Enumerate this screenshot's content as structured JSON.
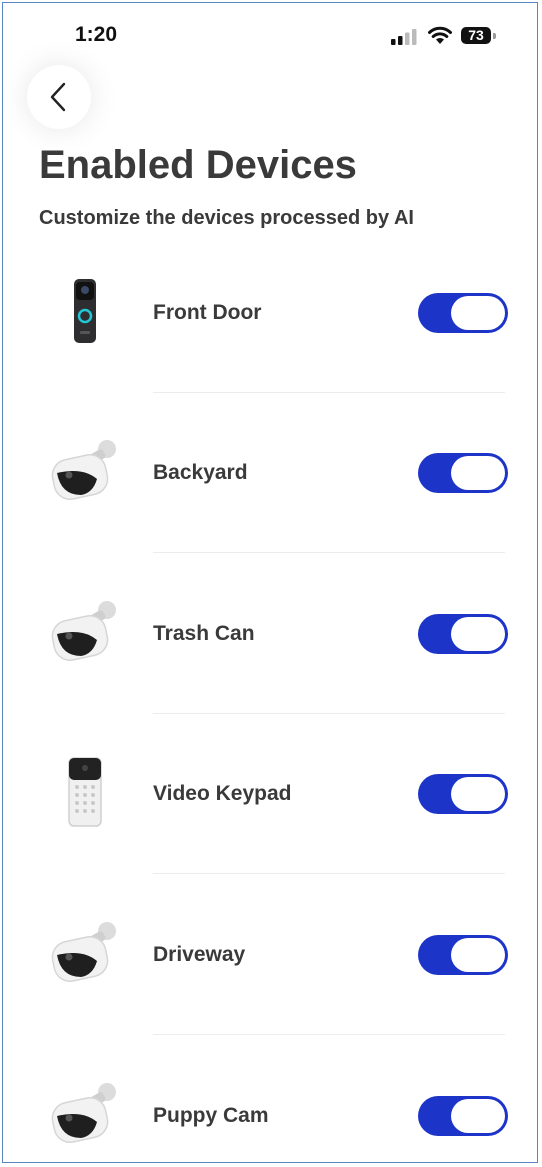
{
  "status_bar": {
    "time": "1:20",
    "battery": "73",
    "icons": [
      "cellular-signal-icon",
      "wifi-icon",
      "battery-icon"
    ]
  },
  "header": {
    "back_icon": "chevron-left-icon",
    "title": "Enabled Devices",
    "subtitle": "Customize the devices processed by AI"
  },
  "colors": {
    "toggle_on": "#1d34c9",
    "text": "#3a3a3a"
  },
  "devices": [
    {
      "name": "Front Door",
      "type": "doorbell",
      "enabled": true
    },
    {
      "name": "Backyard",
      "type": "camera",
      "enabled": true
    },
    {
      "name": "Trash Can",
      "type": "camera",
      "enabled": true
    },
    {
      "name": "Video Keypad",
      "type": "keypad",
      "enabled": true
    },
    {
      "name": "Driveway",
      "type": "camera",
      "enabled": true
    },
    {
      "name": "Puppy Cam",
      "type": "camera",
      "enabled": true
    }
  ]
}
